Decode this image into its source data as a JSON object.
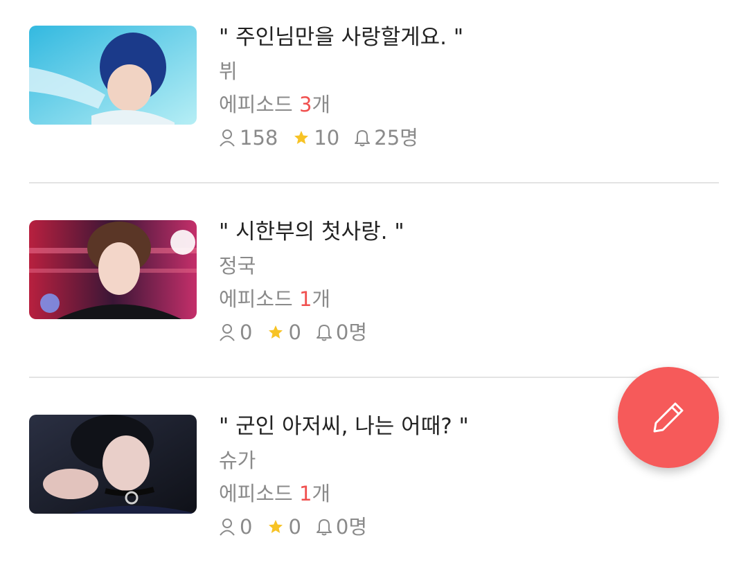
{
  "stories": [
    {
      "title": "\" 주인님만을 사랑할게요. \"",
      "author": "뷔",
      "episode_prefix": "에피소드 ",
      "episode_count": "3",
      "episode_suffix": "개",
      "views": "158",
      "stars": "10",
      "subscribers": "25명",
      "thumb_colors": [
        "#52c7e6",
        "#9de6f0"
      ]
    },
    {
      "title": "\" 시한부의 첫사랑. \"",
      "author": "정국",
      "episode_prefix": "에피소드 ",
      "episode_count": "1",
      "episode_suffix": "개",
      "views": "0",
      "stars": "0",
      "subscribers": "0명",
      "thumb_colors": [
        "#c0264f",
        "#5a1c4a"
      ]
    },
    {
      "title": "\" 군인 아저씨, 나는 어때? \"",
      "author": "슈가",
      "episode_prefix": "에피소드 ",
      "episode_count": "1",
      "episode_suffix": "개",
      "views": "0",
      "stars": "0",
      "subscribers": "0명",
      "thumb_colors": [
        "#1a1d2a",
        "#3a3f52"
      ]
    }
  ],
  "fab": {
    "icon": "pencil-icon",
    "color": "#f65a5a"
  },
  "colors": {
    "accent": "#f0504f",
    "star": "#f7c325",
    "muted": "#8a8a8a"
  }
}
